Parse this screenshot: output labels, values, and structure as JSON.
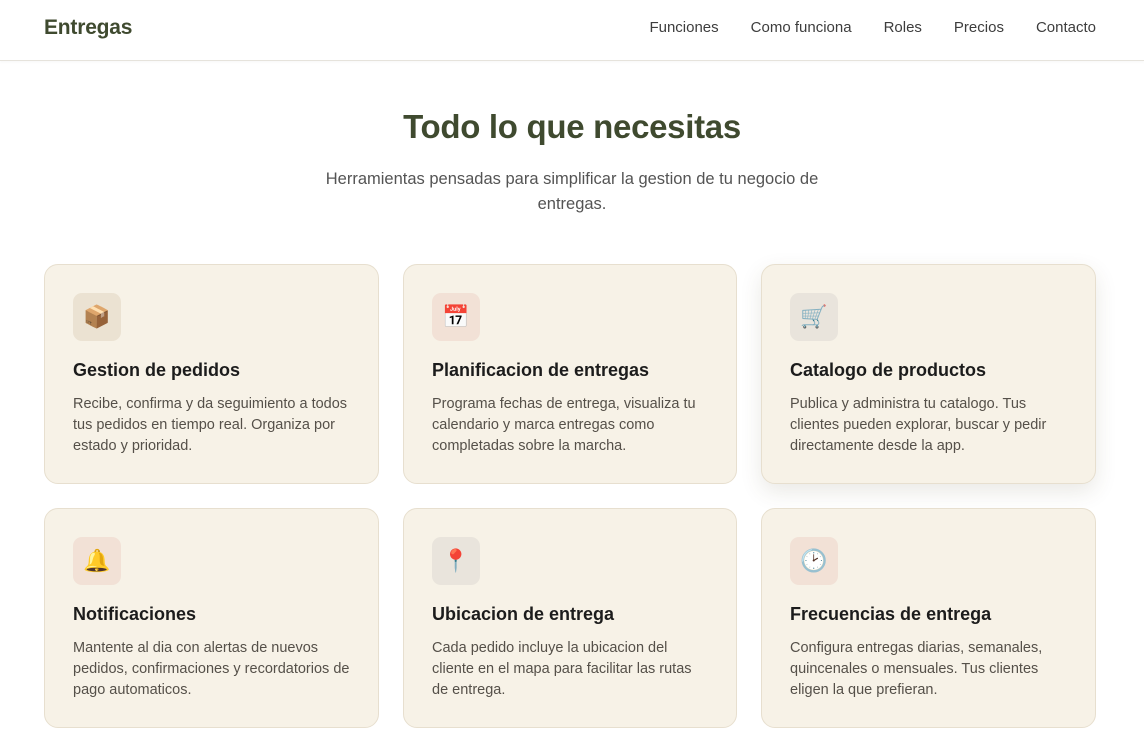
{
  "nav": {
    "brand": "Entregas",
    "links": [
      "Funciones",
      "Como funciona",
      "Roles",
      "Precios",
      "Contacto"
    ]
  },
  "hero": {
    "title": "Todo lo que necesitas",
    "subtitle": "Herramientas pensadas para simplificar la gestion de tu negocio de entregas."
  },
  "features": [
    {
      "icon": "📦",
      "icon_name": "package-icon",
      "title": "Gestion de pedidos",
      "description": "Recibe, confirma y da seguimiento a todos tus pedidos en tiempo real. Organiza por estado y prioridad."
    },
    {
      "icon": "📅",
      "icon_name": "calendar-icon",
      "title": "Planificacion de entregas",
      "description": "Programa fechas de entrega, visualiza tu calendario y marca entregas como completadas sobre la marcha."
    },
    {
      "icon": "🛒",
      "icon_name": "shopping-cart-icon",
      "title": "Catalogo de productos",
      "description": "Publica y administra tu catalogo. Tus clientes pueden explorar, buscar y pedir directamente desde la app."
    },
    {
      "icon": "🔔",
      "icon_name": "bell-icon",
      "title": "Notificaciones",
      "description": "Mantente al dia con alertas de nuevos pedidos, confirmaciones y recordatorios de pago automaticos."
    },
    {
      "icon": "📍",
      "icon_name": "map-pin-icon",
      "title": "Ubicacion de entrega",
      "description": "Cada pedido incluye la ubicacion del cliente en el mapa para facilitar las rutas de entrega."
    },
    {
      "icon": "🕑",
      "icon_name": "clock-icon",
      "title": "Frecuencias de entrega",
      "description": "Configura entregas diarias, semanales, quincenales o mensuales. Tus clientes eligen la que prefieran."
    }
  ],
  "colors": {
    "brand": "#3f4a2f",
    "card_bg": "#f7f2e7",
    "card_border": "#e7dfcf"
  }
}
